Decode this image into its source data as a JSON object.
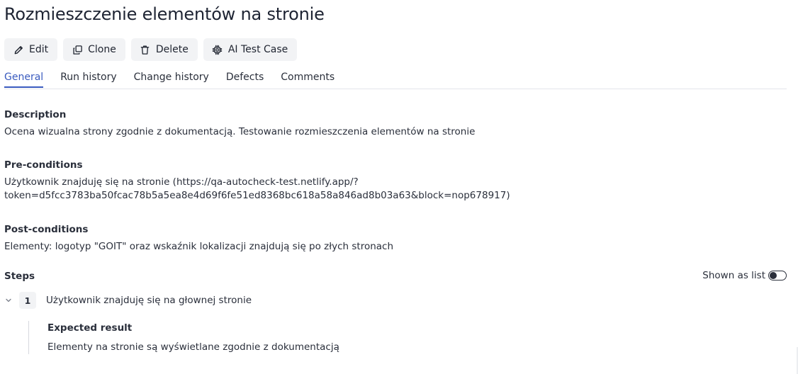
{
  "page": {
    "title": "Rozmieszczenie elementów na stronie"
  },
  "toolbar": {
    "edit_label": "Edit",
    "clone_label": "Clone",
    "delete_label": "Delete",
    "ai_label": "AI Test Case"
  },
  "tabs": [
    {
      "label": "General",
      "active": true
    },
    {
      "label": "Run history",
      "active": false
    },
    {
      "label": "Change history",
      "active": false
    },
    {
      "label": "Defects",
      "active": false
    },
    {
      "label": "Comments",
      "active": false
    }
  ],
  "description": {
    "label": "Description",
    "text": "Ocena wizualna strony zgodnie z dokumentacją. Testowanie rozmieszczenia elementów na stronie"
  },
  "preconditions": {
    "label": "Pre-conditions",
    "line1": "Użytkownik znajduję się na stronie (https://qa-autocheck-test.netlify.app/?",
    "line2": "token=d5fcc3783ba50fcac78b5a5ea8e4d69f6fe51ed8368bc618a58a846ad8b03a63&block=nop678917)"
  },
  "postconditions": {
    "label": "Post-conditions",
    "text": "Elementy: logotyp \"GOIT\" oraz wskaźnik lokalizacji znajdują się po złych stronach"
  },
  "steps": {
    "label": "Steps",
    "toggle_label": "Shown as list",
    "toggle_on": false,
    "items": [
      {
        "number": "1",
        "text": "Użytkownik znajduję się na głownej stronie",
        "expected_label": "Expected result",
        "expected_text": "Elementy na stronie są wyświetlane zgodnie z dokumentacją"
      }
    ]
  },
  "colors": {
    "accent": "#3a5bbf",
    "button_bg": "#f2f3f5",
    "text": "#2a2f3b"
  },
  "icons": {
    "edit": "pencil-icon",
    "clone": "clone-icon",
    "delete": "trash-icon",
    "ai": "chip-icon",
    "step_toggle": "chevron-down-icon"
  }
}
